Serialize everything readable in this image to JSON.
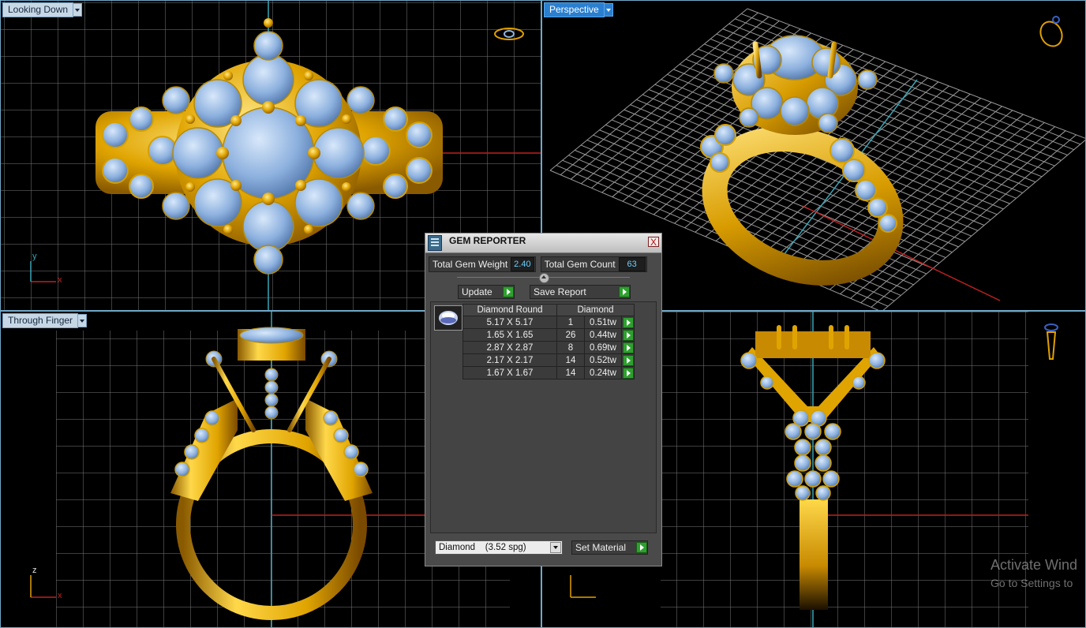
{
  "viewports": {
    "top_left": {
      "label": "Looking Down"
    },
    "top_right": {
      "label": "Perspective"
    },
    "bottom_left": {
      "label": "Through Finger"
    },
    "bottom_right": {
      "label": ""
    }
  },
  "axes": {
    "x": "x",
    "y": "y",
    "z": "z"
  },
  "gem_reporter": {
    "title": "GEM REPORTER",
    "close": "X",
    "total_weight_label": "Total Gem Weight",
    "total_weight_value": "2.40",
    "total_count_label": "Total Gem Count",
    "total_count_value": "63",
    "update_label": "Update",
    "save_report_label": "Save Report",
    "table": {
      "headers": [
        "Diamond Round",
        "Diamond"
      ],
      "rows": [
        {
          "size": "5.17 X 5.17",
          "count": "1",
          "weight": "0.51tw"
        },
        {
          "size": "1.65 X 1.65",
          "count": "26",
          "weight": "0.44tw"
        },
        {
          "size": "2.87 X 2.87",
          "count": "8",
          "weight": "0.69tw"
        },
        {
          "size": "2.17 X 2.17",
          "count": "14",
          "weight": "0.52tw"
        },
        {
          "size": "1.67 X 1.67",
          "count": "14",
          "weight": "0.24tw"
        }
      ]
    },
    "material_value": "Diamond    (3.52 spg)",
    "set_material_label": "Set Material"
  },
  "watermark": {
    "line1": "Activate Wind",
    "line2": "Go to Settings to"
  },
  "colors": {
    "gold": "#e0a800",
    "gem": "#8fb4e0",
    "grid": "#8a8a8a",
    "viewport_border": "#6fa8c8",
    "active_tab": "#2a7fd0"
  }
}
